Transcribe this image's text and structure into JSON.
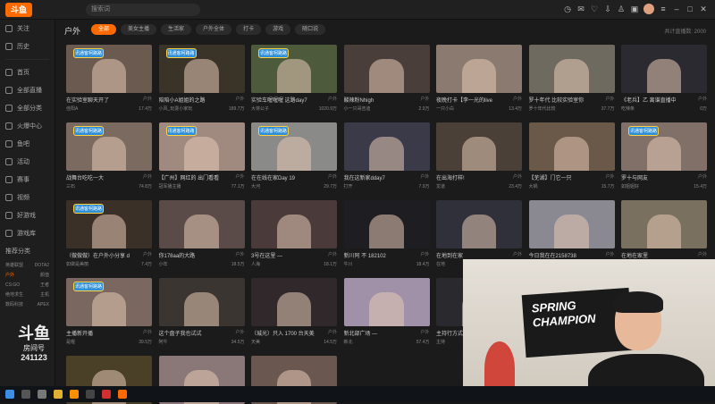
{
  "topbar": {
    "logo_text": "斗鱼",
    "search_placeholder": "搜索词"
  },
  "sidebar": {
    "items": [
      {
        "label": "关注"
      },
      {
        "label": "历史"
      },
      {
        "label": "首页"
      },
      {
        "label": "全部直播"
      },
      {
        "label": "全部分类"
      },
      {
        "label": "火爆中心"
      },
      {
        "label": "鱼吧"
      },
      {
        "label": "活动"
      },
      {
        "label": "赛事"
      },
      {
        "label": "视频"
      },
      {
        "label": "好游戏"
      },
      {
        "label": "游戏库"
      }
    ],
    "section_label": "推荐分类",
    "small_rows": [
      {
        "left": "英雄联盟",
        "right": "DOTA2"
      },
      {
        "left": "户外",
        "right": "颜值"
      },
      {
        "left": "CS:GO",
        "right": "王者"
      },
      {
        "left": "绝地求生",
        "right": "主机"
      },
      {
        "left": "数码科技",
        "right": "APEX"
      }
    ]
  },
  "main": {
    "section_title": "户外",
    "filters": [
      "全部",
      "美女主播",
      "生活家",
      "户外全体",
      "打卡",
      "游戏",
      "随口说"
    ],
    "active_filter": 0,
    "header_right": "共计直播数: 2000"
  },
  "cards": [
    {
      "title": "在实验室聊天开了",
      "cat": "户外",
      "user": "佳阳A",
      "viewers": "17.4万",
      "badge": "讯通客柯路路",
      "color": "#6a5a50"
    },
    {
      "title": "陪陪小A姐姐的之路",
      "cat": "户外",
      "user": "小风_玩耍小家玩",
      "viewers": "189.7万",
      "badge": "讯通客柯路路",
      "color": "#3a3328"
    },
    {
      "title": "实验车喔喔喔 这路day7",
      "cat": "户外",
      "user": "大将公子",
      "viewers": "1020.9万",
      "badge": "讯通客柯路路",
      "color": "#4e5a3c"
    },
    {
      "title": "酸辣粉Nhigh",
      "cat": "户外",
      "user": "小一只哥吉迪",
      "viewers": "2.9万",
      "badge": "",
      "color": "#4a3e3a"
    },
    {
      "title": "夜晚打卡【李一光的live",
      "cat": "户外",
      "user": "一只小白",
      "viewers": "13.4万",
      "badge": "",
      "color": "#8a7a70"
    },
    {
      "title": "罗十年代 比较实验室你",
      "cat": "户外",
      "user": "罗十年代比较",
      "viewers": "37.7万",
      "badge": "",
      "color": "#6f6a60"
    },
    {
      "title": "《老兵】乙 离谱直播中",
      "cat": "户外",
      "user": "吃辣条",
      "viewers": "0万",
      "badge": "",
      "color": "#2a2a30"
    },
    {
      "title": "战舞台吃吃一大",
      "cat": "户外",
      "user": "三石",
      "viewers": "74.8万",
      "badge": "讯通客柯路路",
      "color": "#7a6a60"
    },
    {
      "title": "【广州】网红的 出门看看",
      "cat": "户外",
      "user": "冠军播主播",
      "viewers": "77.1万",
      "badge": "讯通客柯路路",
      "color": "#a08a80"
    },
    {
      "title": "在在线在家Day 19",
      "cat": "户外",
      "user": "大河",
      "viewers": "29.7万",
      "badge": "讯通客柯路路",
      "color": "#8a8a88"
    },
    {
      "title": "我在这新家dday7",
      "cat": "户外",
      "user": "打开",
      "viewers": "7.9万",
      "badge": "",
      "color": "#3a3a48"
    },
    {
      "title": "在出海打样!",
      "cat": "户外",
      "user": "龙道",
      "viewers": "23.4万",
      "badge": "",
      "color": "#4a4038"
    },
    {
      "title": "【芜湖】门它一只",
      "cat": "户外",
      "user": "大锅",
      "viewers": "15.7万",
      "badge": "",
      "color": "#6a5848"
    },
    {
      "title": "罗十与网友",
      "cat": "户外",
      "user": "如姐姐好",
      "viewers": "15.4万",
      "badge": "讯通客柯路路",
      "color": "#807068"
    },
    {
      "title": "（做做做）在户外小分享 d",
      "cat": "户外",
      "user": "如做是美丽",
      "viewers": "7.4万",
      "badge": "讯通客柯路路",
      "color": "#3a3028"
    },
    {
      "title": "你178aa的大路",
      "cat": "户外",
      "user": "小年",
      "viewers": "18.5万",
      "badge": "",
      "color": "#5a4a48"
    },
    {
      "title": "3号在这里 — ",
      "cat": "户外",
      "user": "人海",
      "viewers": "18.1万",
      "badge": "",
      "color": "#4a3a3a"
    },
    {
      "title": "新川阿 不 182102",
      "cat": "户外",
      "user": "牛川",
      "viewers": "18.4万",
      "badge": "",
      "color": "#1e1e22"
    },
    {
      "title": "在地到在家",
      "cat": "户外",
      "user": "在地",
      "viewers": "12.7万",
      "badge": "",
      "color": "#30303a"
    },
    {
      "title": "今日我在在2158738",
      "cat": "户外",
      "user": "今日",
      "viewers": "9.9万",
      "badge": "",
      "color": "#8a8890"
    },
    {
      "title": "在地在家里",
      "cat": "户外",
      "user": "大王",
      "viewers": "9.2万",
      "badge": "",
      "color": "#7a7060"
    },
    {
      "title": "主播新开播",
      "cat": "户外",
      "user": "是喔",
      "viewers": "39.5万",
      "badge": "讯通客柯路路",
      "color": "#7a6860"
    },
    {
      "title": "这个盘子我也试试",
      "cat": "户外",
      "user": "阿牛",
      "viewers": "34.5万",
      "badge": "",
      "color": "#3a3530"
    },
    {
      "title": "（城光）只入 1700 台天美",
      "cat": "户外",
      "user": "天美",
      "viewers": "14.5万",
      "badge": "",
      "color": "#30282a"
    },
    {
      "title": "新北部广场 —",
      "cat": "户外",
      "user": "新北",
      "viewers": "57.4万",
      "badge": "",
      "color": "#a090a8"
    },
    {
      "title": "主持行方式",
      "cat": "户外",
      "user": "主持",
      "viewers": "29.5万",
      "badge": "",
      "color": "#2a2a2e"
    },
    {
      "title": "",
      "cat": "",
      "user": "",
      "viewers": "",
      "badge": "讯通客柯路路",
      "color": "#9a8880"
    },
    {
      "title": "",
      "cat": "",
      "user": "",
      "viewers": "",
      "badge": "",
      "color": "#c0a8a0"
    },
    {
      "title": "",
      "cat": "",
      "user": "",
      "viewers": "",
      "badge": "",
      "color": "#4a4028"
    },
    {
      "title": "",
      "cat": "",
      "user": "",
      "viewers": "",
      "badge": "",
      "color": "#8a7878"
    },
    {
      "title": "",
      "cat": "",
      "user": "",
      "viewers": "",
      "badge": "",
      "color": "#6a5850"
    }
  ],
  "watermark": {
    "logo": "斗鱼",
    "text": "房间号",
    "room_number": "241123"
  },
  "cam": {
    "flag_text": "SPRING CHAMPION"
  }
}
